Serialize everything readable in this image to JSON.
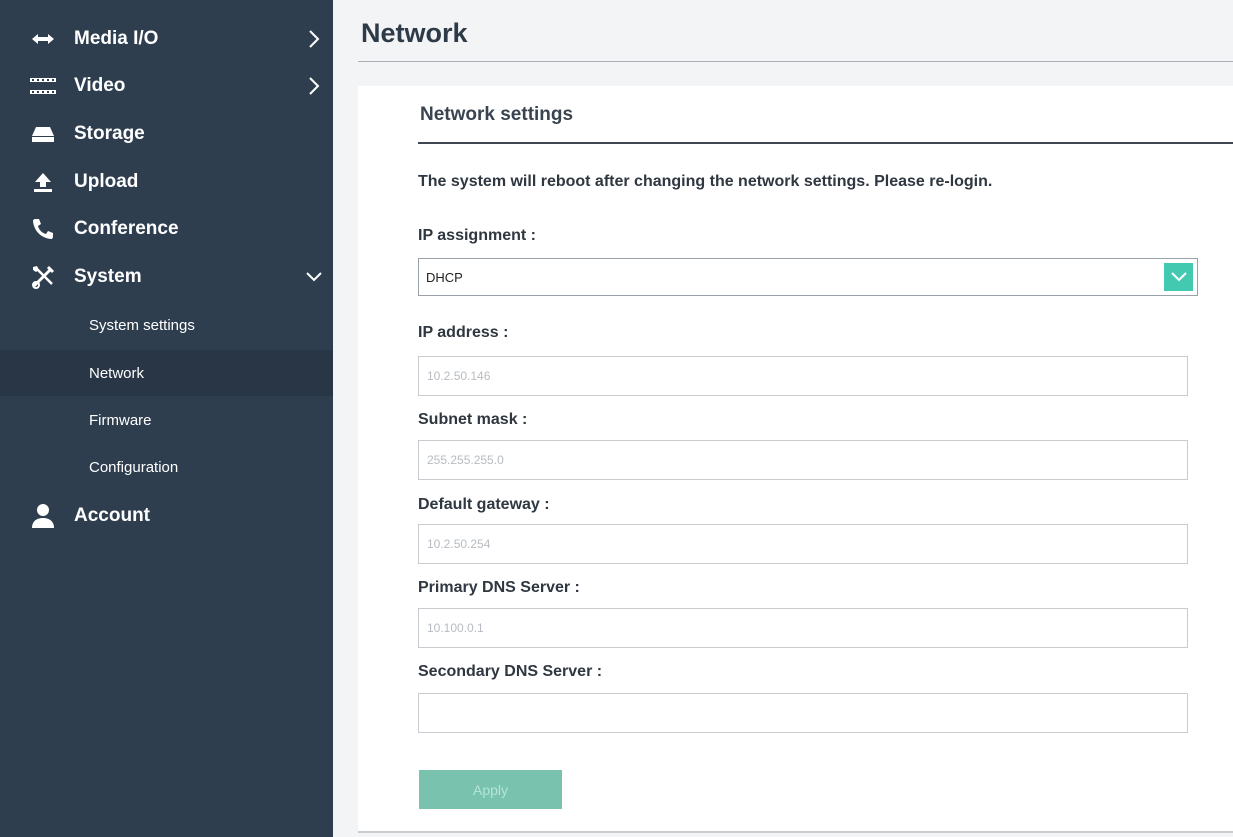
{
  "sidebar": {
    "items": [
      {
        "label": "Media I/O",
        "icon": "arrows-icon"
      },
      {
        "label": "Video",
        "icon": "film-strip-icon"
      },
      {
        "label": "Storage",
        "icon": "storage-drive-icon"
      },
      {
        "label": "Upload",
        "icon": "upload-icon"
      },
      {
        "label": "Conference",
        "icon": "phone-icon"
      },
      {
        "label": "System",
        "icon": "tools-icon"
      },
      {
        "label": "Account",
        "icon": "user-icon"
      }
    ],
    "system_subitems": [
      {
        "label": "System settings"
      },
      {
        "label": "Network",
        "active": true
      },
      {
        "label": "Firmware"
      },
      {
        "label": "Configuration"
      }
    ]
  },
  "page": {
    "title": "Network"
  },
  "network_settings": {
    "title": "Network settings",
    "notice": "The system will reboot after changing the network settings. Please re-login.",
    "ip_assignment": {
      "label": "IP assignment :",
      "value": "DHCP"
    },
    "ip_address": {
      "label": "IP address :",
      "placeholder": "10.2.50.146"
    },
    "subnet_mask": {
      "label": "Subnet mask :",
      "placeholder": "255.255.255.0"
    },
    "default_gateway": {
      "label": "Default gateway :",
      "placeholder": "10.2.50.254"
    },
    "primary_dns": {
      "label": "Primary DNS Server :",
      "placeholder": "10.100.0.1"
    },
    "secondary_dns": {
      "label": "Secondary DNS Server :",
      "placeholder": ""
    },
    "apply_label": "Apply"
  },
  "colors": {
    "sidebar_bg": "#2e3e4f",
    "sidebar_active_bg": "#283645",
    "accent": "#43c9b0",
    "apply_button_bg": "#79c3ae"
  }
}
